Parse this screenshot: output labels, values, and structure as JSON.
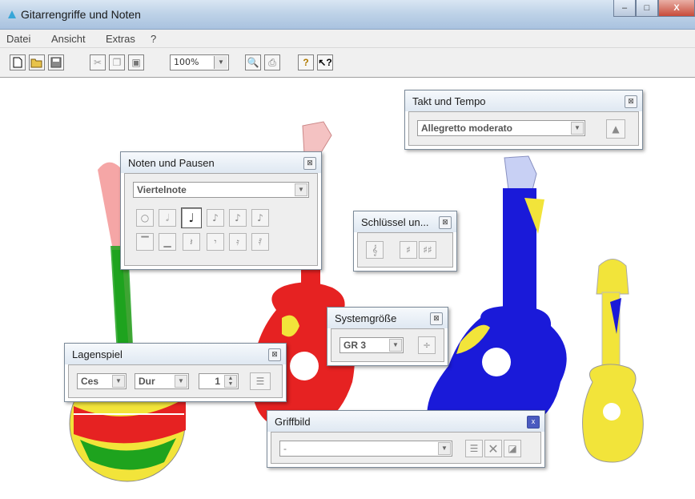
{
  "window": {
    "title": "Gitarrengriffe und Noten",
    "min_label": "–",
    "max_label": "□",
    "close_label": "X"
  },
  "menu": [
    "Datei",
    "Ansicht",
    "Extras",
    "?"
  ],
  "toolbar": {
    "icons": [
      "new-document-icon",
      "open-folder-icon",
      "save-icon",
      "cut-icon",
      "copy-icon",
      "paste-icon",
      "print-preview-icon",
      "print-icon",
      "help-icon",
      "context-help-icon"
    ],
    "zoom_value": "100%"
  },
  "panels": {
    "takt": {
      "title": "Takt und Tempo",
      "tempo": "Allegretto moderato"
    },
    "noten": {
      "title": "Noten und Pausen",
      "selected": "Viertelnote",
      "notes": [
        "○",
        "𝅗𝅥",
        "♩",
        "♪",
        "♪",
        "♪"
      ],
      "rests": [
        "▔",
        "▁",
        "𝄽",
        "𝄾",
        "𝄿",
        "𝅀"
      ]
    },
    "schluessel": {
      "title": "Schlüssel un..."
    },
    "system": {
      "title": "Systemgröße",
      "size": "GR 3"
    },
    "lagen": {
      "title": "Lagenspiel",
      "key": "Ces",
      "mode": "Dur",
      "position": "1"
    },
    "griff": {
      "title": "Griffbild",
      "value": "-"
    }
  },
  "colors": {
    "guitar_green": "#1ea31e",
    "guitar_red": "#e62222",
    "guitar_blue": "#1a1ad9",
    "guitar_yellow": "#f2e43a"
  }
}
